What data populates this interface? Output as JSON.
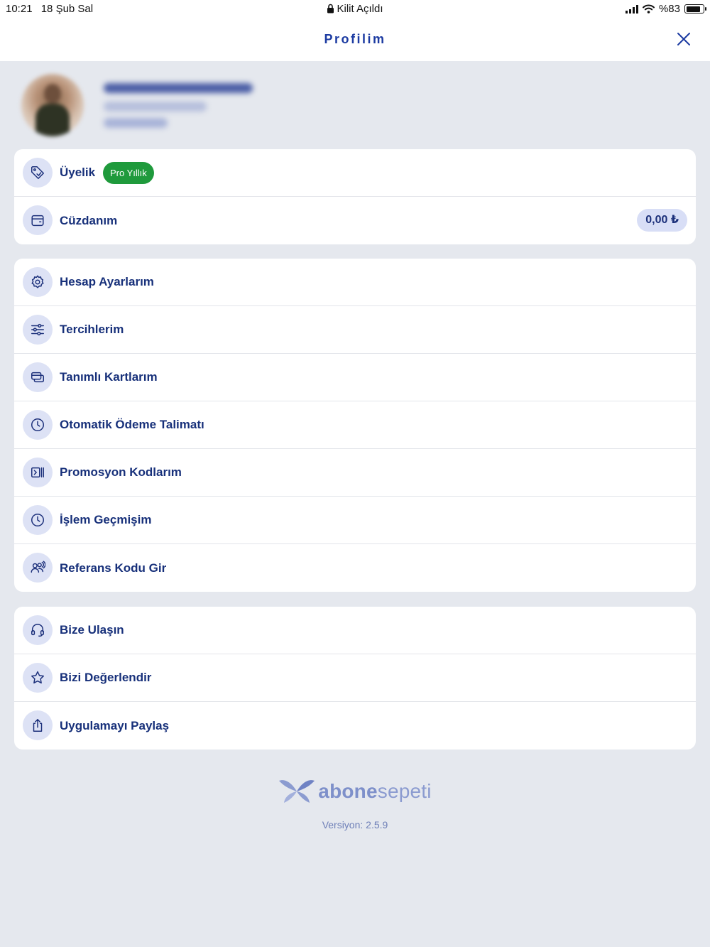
{
  "status_bar": {
    "time": "10:21",
    "date": "18 Şub Sal",
    "center": "Kilit Açıldı",
    "battery": "%83",
    "battery_level": 0.83
  },
  "nav": {
    "title": "Profilim",
    "close_icon": "close-icon"
  },
  "colors": {
    "primary_text": "#17307a",
    "accent": "#1b3aa1",
    "badge_green": "#1f9a3c",
    "icon_bg": "#dde2f5",
    "page_bg": "#e5e8ee"
  },
  "section1": {
    "membership": {
      "label": "Üyelik",
      "badge": "Pro Yıllık",
      "icon": "tag-icon"
    },
    "wallet": {
      "label": "Cüzdanım",
      "amount": "0,00 ₺",
      "icon": "wallet-icon"
    }
  },
  "section2": {
    "items": [
      {
        "label": "Hesap Ayarlarım",
        "icon": "gear-icon"
      },
      {
        "label": "Tercihlerim",
        "icon": "sliders-icon"
      },
      {
        "label": "Tanımlı Kartlarım",
        "icon": "cards-icon"
      },
      {
        "label": "Otomatik Ödeme Talimatı",
        "icon": "clock-icon"
      },
      {
        "label": "Promosyon Kodlarım",
        "icon": "promo-code-icon"
      },
      {
        "label": "İşlem Geçmişim",
        "icon": "history-icon"
      },
      {
        "label": "Referans Kodu Gir",
        "icon": "users-icon"
      }
    ]
  },
  "section3": {
    "items": [
      {
        "label": "Bize Ulaşın",
        "icon": "headset-icon"
      },
      {
        "label": "Bizi Değerlendir",
        "icon": "star-icon"
      },
      {
        "label": "Uygulamayı Paylaş",
        "icon": "share-icon"
      }
    ]
  },
  "footer": {
    "brand_bold": "abone",
    "brand_light": "sepeti",
    "version": "Versiyon: 2.5.9"
  }
}
